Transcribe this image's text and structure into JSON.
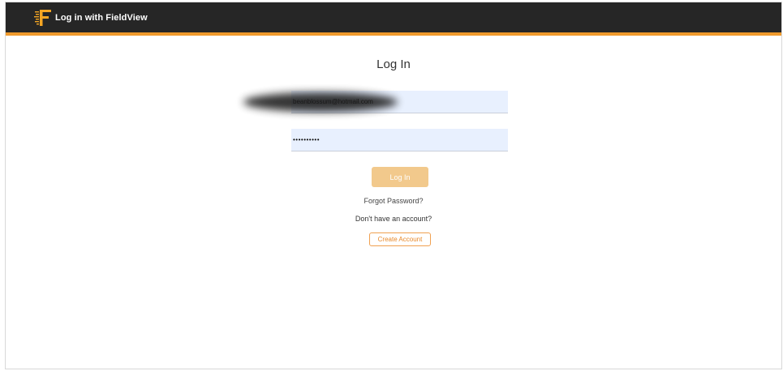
{
  "header": {
    "title": "Log in with FieldView",
    "logo_icon": "fieldview-logo-icon",
    "bar_color": "#262626",
    "accent_color": "#f09a2c"
  },
  "login_form": {
    "heading": "Log In",
    "email_value": "beanblossum@hotmail.com",
    "password_value": "••••••••••",
    "submit_label": "Log In",
    "forgot_password_label": "Forgot Password?",
    "no_account_text": "Don't have an account?",
    "create_account_label": "Create Account",
    "input_background": "#e8f0fe",
    "submit_color": "#f2c98c"
  }
}
